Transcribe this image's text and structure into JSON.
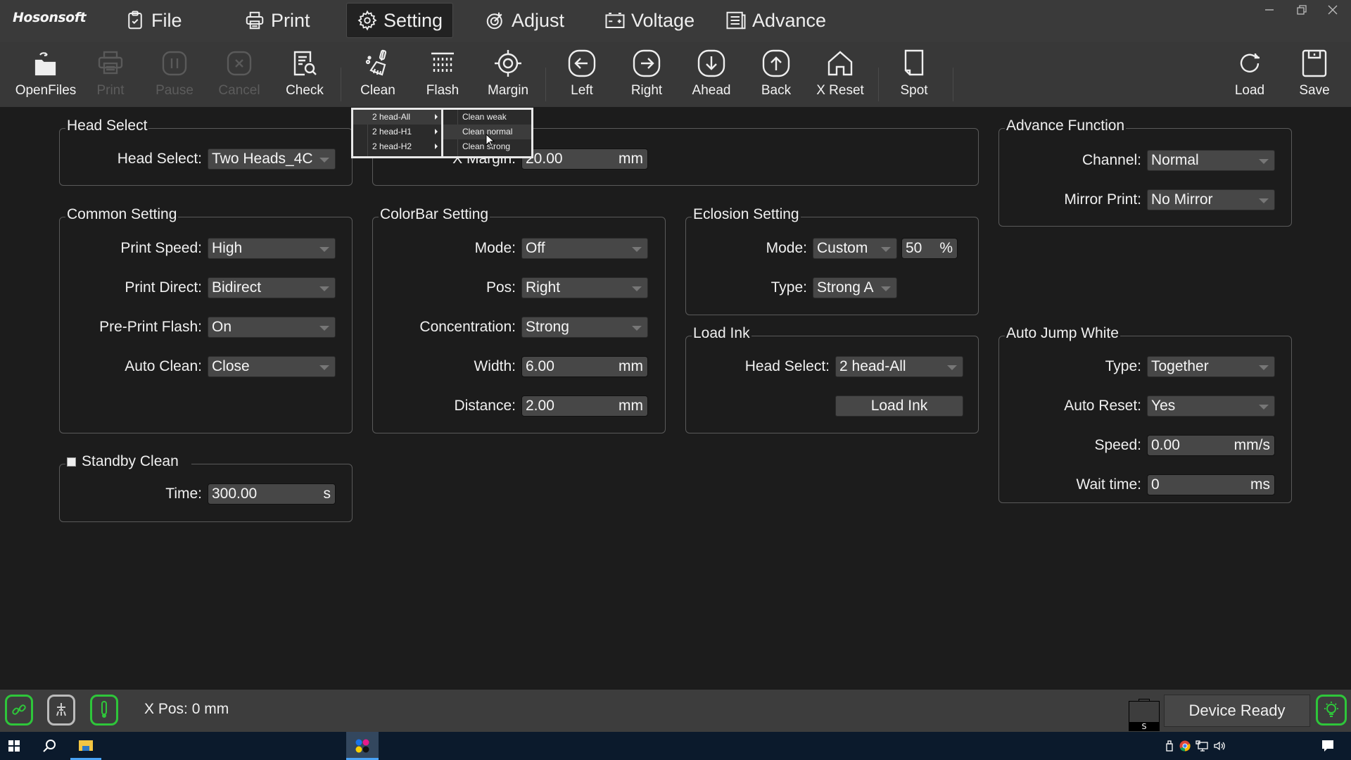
{
  "app": {
    "logo": "Hosonsoft",
    "menu": [
      {
        "label": "File",
        "icon": "clipboard-check-icon"
      },
      {
        "label": "Print",
        "icon": "printer-icon"
      },
      {
        "label": "Setting",
        "icon": "gear-icon",
        "active": true
      },
      {
        "label": "Adjust",
        "icon": "target-icon"
      },
      {
        "label": "Voltage",
        "icon": "battery-icon"
      },
      {
        "label": "Advance",
        "icon": "list-icon"
      }
    ],
    "window_controls": [
      "minimize",
      "restore",
      "close"
    ]
  },
  "toolbar": {
    "items": [
      {
        "label": "OpenFiles",
        "icon": "open-folder-icon",
        "enabled": true
      },
      {
        "label": "Print",
        "icon": "printer-icon",
        "enabled": false
      },
      {
        "label": "Pause",
        "icon": "pause-icon",
        "enabled": false
      },
      {
        "label": "Cancel",
        "icon": "cancel-icon",
        "enabled": false
      },
      {
        "label": "Check",
        "icon": "document-search-icon",
        "enabled": true
      },
      {
        "label": "Clean",
        "icon": "broom-icon",
        "enabled": true
      },
      {
        "label": "Flash",
        "icon": "flash-grid-icon",
        "enabled": true
      },
      {
        "label": "Margin",
        "icon": "crosshair-icon",
        "enabled": true
      },
      {
        "label": "Left",
        "icon": "arrow-left-icon",
        "enabled": true
      },
      {
        "label": "Right",
        "icon": "arrow-right-icon",
        "enabled": true
      },
      {
        "label": "Ahead",
        "icon": "arrow-down-icon",
        "enabled": true
      },
      {
        "label": "Back",
        "icon": "arrow-up-icon",
        "enabled": true
      },
      {
        "label": "X Reset",
        "icon": "home-icon",
        "enabled": true
      },
      {
        "label": "Spot",
        "icon": "page-icon",
        "enabled": true
      },
      {
        "label": "Load",
        "icon": "refresh-icon",
        "enabled": true
      },
      {
        "label": "Save",
        "icon": "floppy-icon",
        "enabled": true
      }
    ]
  },
  "clean_menu": {
    "heads": [
      "2 head-All",
      "2 head-H1",
      "2 head-H2"
    ],
    "submenu": [
      "Clean weak",
      "Clean normal",
      "Clean strong"
    ],
    "hovered_submenu": "Clean normal"
  },
  "head_select": {
    "title": "Head Select",
    "label": "Head Select:",
    "value": "Two Heads_4C"
  },
  "margin": {
    "label": "X Margin:",
    "value": "20.00",
    "unit": "mm"
  },
  "common": {
    "title": "Common Setting",
    "rows": [
      {
        "label": "Print Speed:",
        "value": "High"
      },
      {
        "label": "Print Direct:",
        "value": "Bidirect"
      },
      {
        "label": "Pre-Print Flash:",
        "value": "On"
      },
      {
        "label": "Auto Clean:",
        "value": "Close"
      }
    ]
  },
  "colorbar": {
    "title": "ColorBar Setting",
    "mode": {
      "label": "Mode:",
      "value": "Off"
    },
    "pos": {
      "label": "Pos:",
      "value": "Right"
    },
    "concentration": {
      "label": "Concentration:",
      "value": "Strong"
    },
    "width": {
      "label": "Width:",
      "value": "6.00",
      "unit": "mm"
    },
    "distance": {
      "label": "Distance:",
      "value": "2.00",
      "unit": "mm"
    }
  },
  "eclosion": {
    "title": "Eclosion Setting",
    "mode": {
      "label": "Mode:",
      "value": "Custom",
      "percent": "50",
      "unit": "%"
    },
    "type": {
      "label": "Type:",
      "value": "Strong A"
    }
  },
  "load_ink": {
    "title": "Load Ink",
    "head": {
      "label": "Head Select:",
      "value": "2 head-All"
    },
    "button": "Load Ink"
  },
  "standby": {
    "title": "Standby Clean",
    "checked": false,
    "time": {
      "label": "Time:",
      "value": "300.00",
      "unit": "s"
    }
  },
  "advance": {
    "title": "Advance Function",
    "channel": {
      "label": "Channel:",
      "value": "Normal"
    },
    "mirror": {
      "label": "Mirror Print:",
      "value": "No Mirror"
    }
  },
  "jump_white": {
    "title": "Auto Jump White",
    "type": {
      "label": "Type:",
      "value": "Together"
    },
    "reset": {
      "label": "Auto Reset:",
      "value": "Yes"
    },
    "speed": {
      "label": "Speed:",
      "value": "0.00",
      "unit": "mm/s"
    },
    "wait": {
      "label": "Wait time:",
      "value": "0",
      "unit": "ms"
    }
  },
  "status": {
    "xpos": "X Pos: 0 mm",
    "ink_label": "S",
    "device": "Device Ready",
    "ok_color": "#2ec63a"
  }
}
